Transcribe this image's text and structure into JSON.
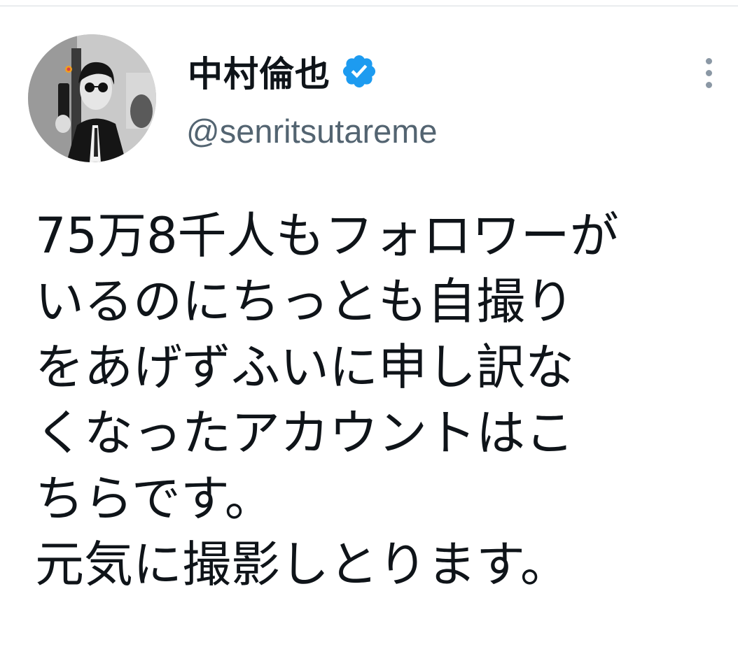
{
  "author": {
    "display_name": "中村倫也",
    "handle": "@senritsutareme",
    "verified": true
  },
  "tweet": {
    "lines": [
      "75万8千人もフォロワーが",
      "いるのにちっとも自撮り",
      "をあげずふいに申し訳な",
      "くなったアカウントはこ",
      "ちらです。",
      "元気に撮影しとります。"
    ]
  },
  "colors": {
    "verified_badge": "#1d9bf0",
    "handle_text": "#536471",
    "body_text": "#0f1419",
    "menu_dots": "#8b98a5"
  },
  "icons": {
    "verified": "verified-badge-icon",
    "more": "more-vertical-icon"
  }
}
